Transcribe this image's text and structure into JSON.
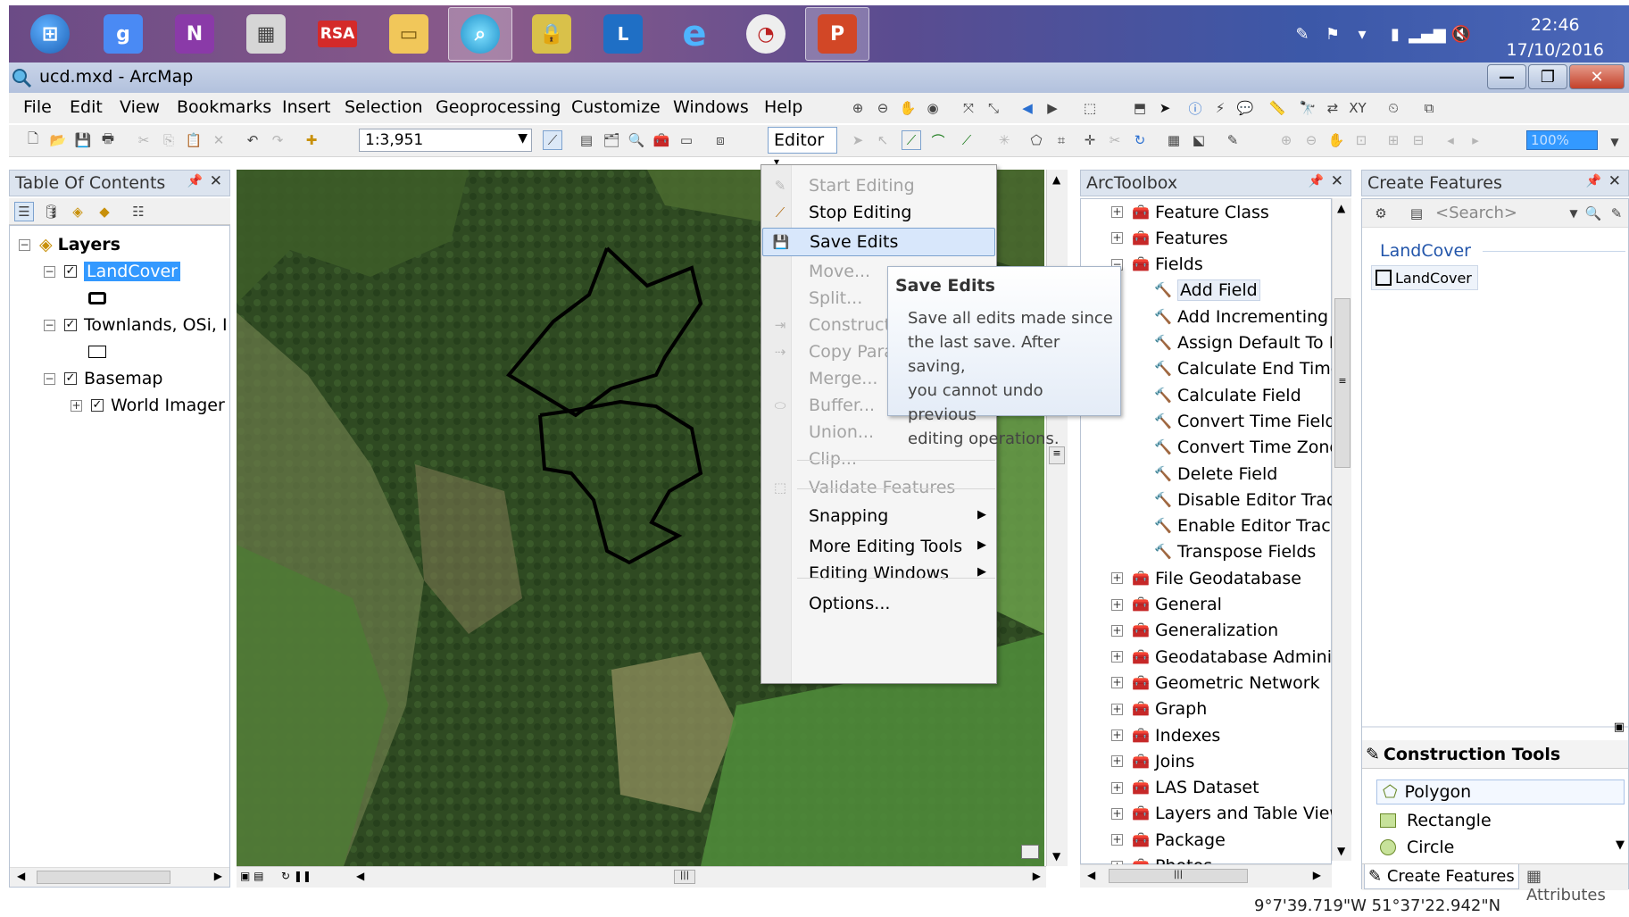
{
  "taskbar": {
    "items": [
      "start-orb",
      "google",
      "onenote",
      "calculator",
      "rsa",
      "file-explorer",
      "search-app",
      "keepass",
      "lync",
      "internet-explorer",
      "time-app",
      "powerpoint"
    ],
    "time": "22:46",
    "date": "17/10/2016"
  },
  "window": {
    "title": "ucd.mxd - ArcMap"
  },
  "menubar": [
    "File",
    "Edit",
    "View",
    "Bookmarks",
    "Insert",
    "Selection",
    "Geoprocessing",
    "Customize",
    "Windows",
    "Help"
  ],
  "toolbar": {
    "scale": "1:3,951",
    "editor_label": "Editor",
    "zoom": "100%"
  },
  "toc": {
    "title": "Table Of Contents",
    "layers_label": "Layers",
    "items": [
      {
        "label": "LandCover"
      },
      {
        "label": "Townlands, OSi, I"
      },
      {
        "label": "Basemap"
      },
      {
        "label": "World Imager"
      }
    ]
  },
  "editor_menu": {
    "items": [
      {
        "label": "Start Editing",
        "enabled": false
      },
      {
        "label": "Stop Editing",
        "enabled": true
      },
      {
        "label": "Save Edits",
        "enabled": true
      },
      {
        "label": "Move...",
        "enabled": false
      },
      {
        "label": "Split...",
        "enabled": false
      },
      {
        "label": "Construct",
        "enabled": false
      },
      {
        "label": "Copy Para",
        "enabled": false
      },
      {
        "label": "Merge...",
        "enabled": false
      },
      {
        "label": "Buffer...",
        "enabled": false
      },
      {
        "label": "Union...",
        "enabled": false
      },
      {
        "label": "Clip...",
        "enabled": false
      },
      {
        "label": "Validate Features",
        "enabled": false
      },
      {
        "label": "Snapping",
        "enabled": true
      },
      {
        "label": "More Editing Tools",
        "enabled": true
      },
      {
        "label": "Editing Windows",
        "enabled": true
      },
      {
        "label": "Options...",
        "enabled": true
      }
    ]
  },
  "tooltip": {
    "title": "Save Edits",
    "lines": [
      "Save all edits made since",
      "the last save. After saving,",
      "you cannot undo previous",
      "editing operations."
    ]
  },
  "toolbox": {
    "title": "ArcToolbox",
    "rows": [
      {
        "label": "Feature Class",
        "kind": "toolbox"
      },
      {
        "label": "Features",
        "kind": "toolbox"
      },
      {
        "label": "Fields",
        "kind": "toolbox"
      },
      {
        "label": "Add Field",
        "kind": "tool"
      },
      {
        "label": "Add Incrementing I",
        "kind": "tool"
      },
      {
        "label": "Assign Default To F",
        "kind": "tool"
      },
      {
        "label": "Calculate End Time",
        "kind": "tool"
      },
      {
        "label": "Calculate Field",
        "kind": "tool"
      },
      {
        "label": "Convert Time Field",
        "kind": "tool"
      },
      {
        "label": "Convert Time Zone",
        "kind": "tool"
      },
      {
        "label": "Delete Field",
        "kind": "tool"
      },
      {
        "label": "Disable Editor Trac",
        "kind": "tool"
      },
      {
        "label": "Enable Editor Track",
        "kind": "tool"
      },
      {
        "label": "Transpose Fields",
        "kind": "tool"
      },
      {
        "label": "File Geodatabase",
        "kind": "toolbox"
      },
      {
        "label": "General",
        "kind": "toolbox"
      },
      {
        "label": "Generalization",
        "kind": "toolbox"
      },
      {
        "label": "Geodatabase Adminis",
        "kind": "toolbox"
      },
      {
        "label": "Geometric Network",
        "kind": "toolbox"
      },
      {
        "label": "Graph",
        "kind": "toolbox"
      },
      {
        "label": "Indexes",
        "kind": "toolbox"
      },
      {
        "label": "Joins",
        "kind": "toolbox"
      },
      {
        "label": "LAS Dataset",
        "kind": "toolbox"
      },
      {
        "label": "Layers and Table View",
        "kind": "toolbox"
      },
      {
        "label": "Package",
        "kind": "toolbox"
      },
      {
        "label": "Photos",
        "kind": "toolbox"
      }
    ]
  },
  "create_features": {
    "title": "Create Features",
    "search_placeholder": "<Search>",
    "group": "LandCover",
    "template": "LandCover",
    "construction_title": "Construction Tools",
    "tools": [
      "Polygon",
      "Rectangle",
      "Circle"
    ],
    "tabs": [
      "Create Features",
      "Attributes"
    ]
  },
  "status": {
    "coordinates": "9°7'39.719\"W  51°37'22.942\"N"
  }
}
